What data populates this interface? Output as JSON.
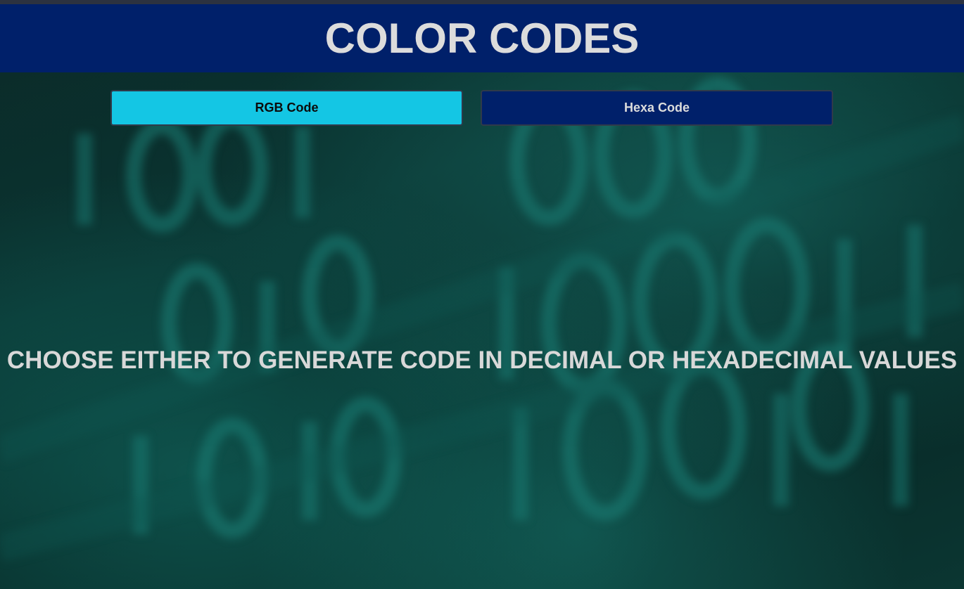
{
  "header": {
    "title": "COLOR CODES"
  },
  "buttons": {
    "rgb_label": "RGB Code",
    "hexa_label": "Hexa Code"
  },
  "main": {
    "message": "CHOOSE EITHER TO GENERATE CODE IN DECIMAL OR HEXADECIMAL VALUES"
  },
  "colors": {
    "header_bg": "#00206a",
    "rgb_button_bg": "#14c6e4",
    "hexa_button_bg": "#00206a",
    "text": "#dcdcdc"
  }
}
